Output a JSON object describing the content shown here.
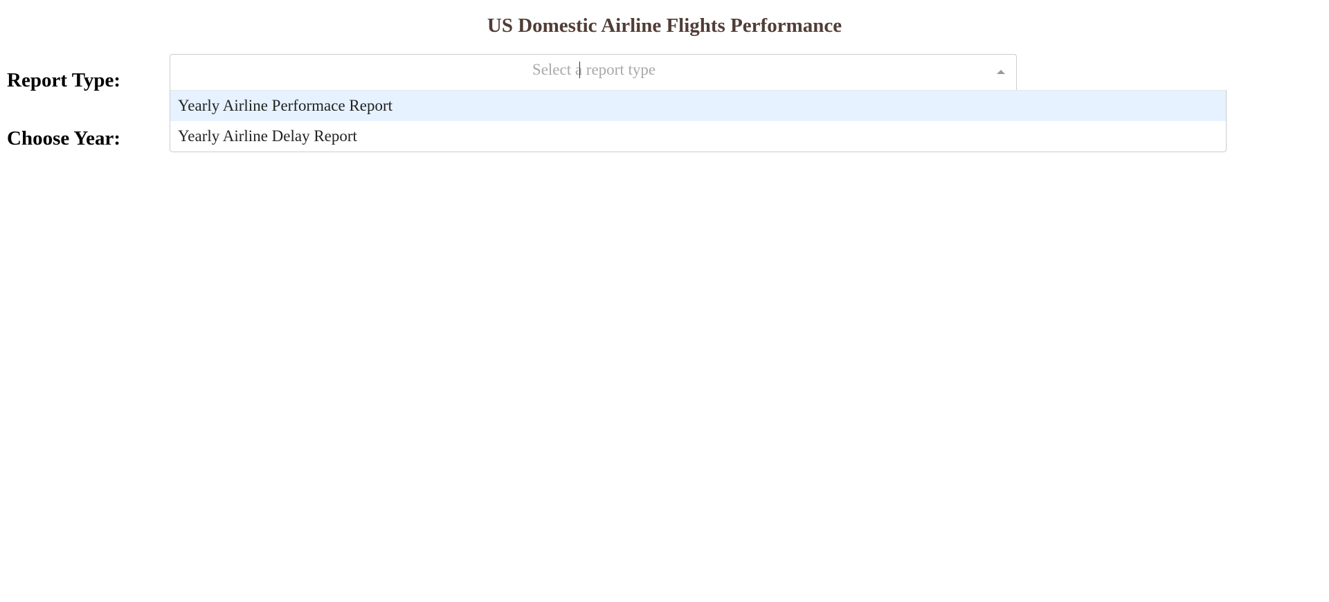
{
  "header": {
    "title": "US Domestic Airline Flights Performance"
  },
  "form": {
    "report_type_label": "Report Type:",
    "year_label": "Choose Year:"
  },
  "report_select": {
    "placeholder": "Select a report type",
    "is_open": true,
    "options": [
      {
        "label": "Yearly Airline Performace Report",
        "focused": true
      },
      {
        "label": "Yearly Airline Delay Report",
        "focused": false
      }
    ]
  },
  "colors": {
    "title": "#503d36",
    "placeholder": "#a9a9a9",
    "option_focus_bg": "#e6f2ff",
    "border": "#cccccc"
  },
  "icons": {
    "dropdown_arrow": "chevron-up-icon"
  }
}
